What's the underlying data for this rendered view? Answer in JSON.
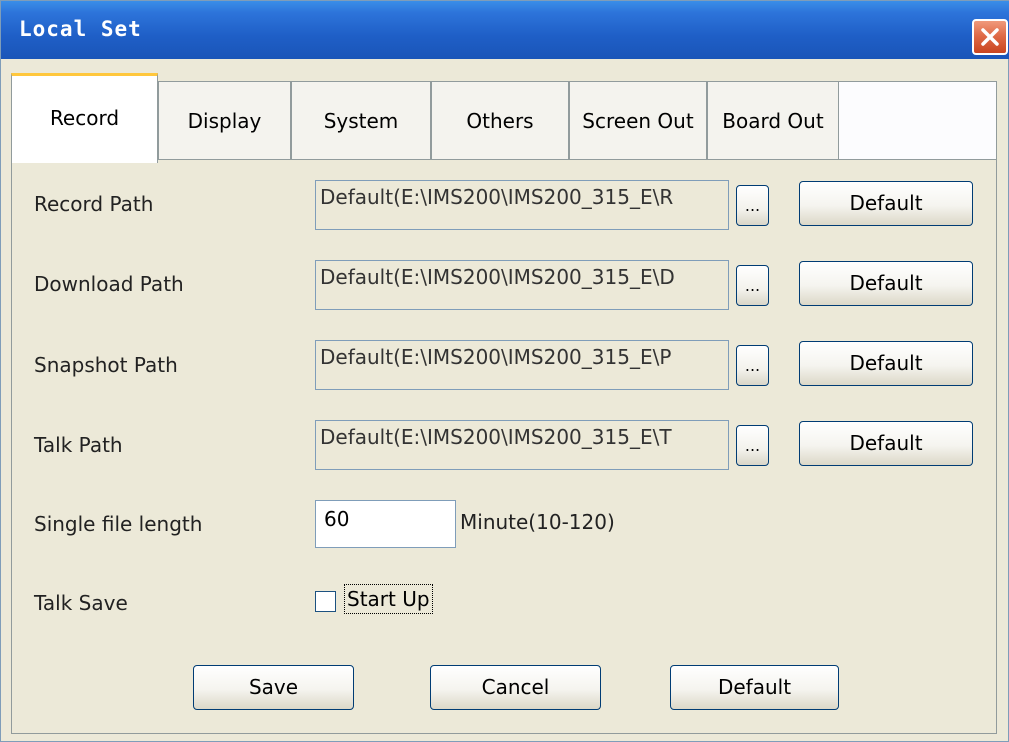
{
  "window": {
    "title": "Local Set"
  },
  "tabs": [
    "Record",
    "Display",
    "System",
    "Others",
    "Screen Out",
    "Board Out"
  ],
  "paths": [
    {
      "label": "Record Path",
      "value": "Default(E:\\IMS200\\IMS200_315_E\\R",
      "browse": "...",
      "default_label": "Default"
    },
    {
      "label": "Download Path",
      "value": "Default(E:\\IMS200\\IMS200_315_E\\D",
      "browse": "...",
      "default_label": "Default"
    },
    {
      "label": "Snapshot Path",
      "value": "Default(E:\\IMS200\\IMS200_315_E\\P",
      "browse": "...",
      "default_label": "Default"
    },
    {
      "label": "Talk Path",
      "value": "Default(E:\\IMS200\\IMS200_315_E\\T",
      "browse": "...",
      "default_label": "Default"
    }
  ],
  "single_file": {
    "label": "Single file length",
    "value": "60",
    "unit": "Minute(10-120)"
  },
  "talk_save": {
    "label": "Talk Save",
    "checkbox_label": "Start Up",
    "checked": false
  },
  "footer": {
    "save": "Save",
    "cancel": "Cancel",
    "default": "Default"
  }
}
